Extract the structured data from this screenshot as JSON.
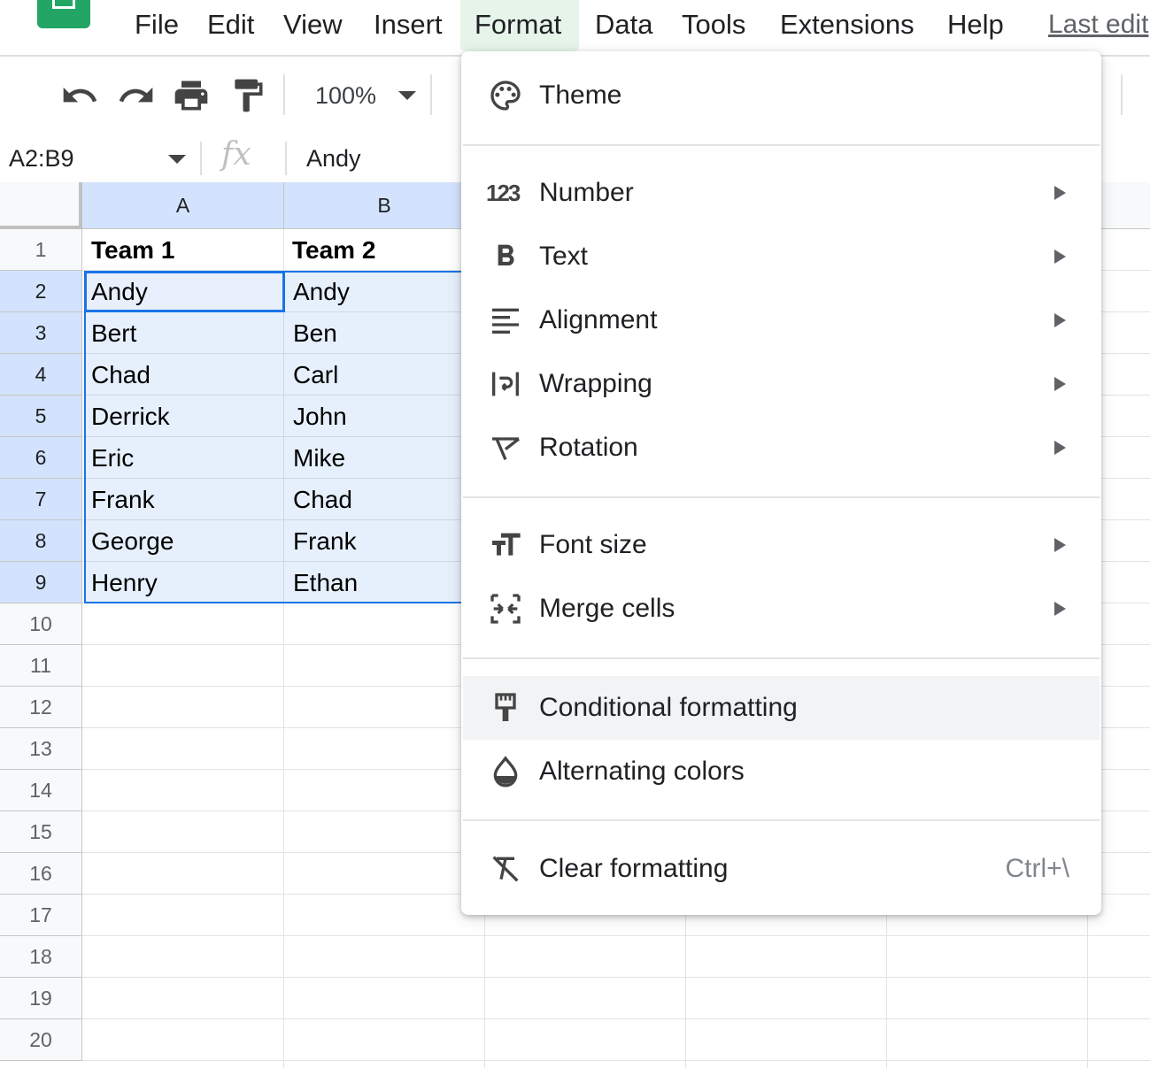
{
  "menubar": {
    "items": [
      "File",
      "Edit",
      "View",
      "Insert",
      "Format",
      "Data",
      "Tools",
      "Extensions",
      "Help"
    ],
    "active": "Format",
    "last_edit": "Last edit"
  },
  "toolbar": {
    "zoom": "100%",
    "icons": [
      "undo-icon",
      "redo-icon",
      "print-icon",
      "paint-format-icon"
    ]
  },
  "formula_bar": {
    "name_box": "A2:B9",
    "fx": "fx",
    "value": "Andy"
  },
  "sheet": {
    "columns": [
      "A",
      "B"
    ],
    "rows": [
      "1",
      "2",
      "3",
      "4",
      "5",
      "6",
      "7",
      "8",
      "9",
      "10",
      "11",
      "12",
      "13",
      "14",
      "15",
      "16",
      "17",
      "18",
      "19",
      "20"
    ],
    "header": [
      "Team 1",
      "Team 2"
    ],
    "data": [
      [
        "Andy",
        "Andy"
      ],
      [
        "Bert",
        "Ben"
      ],
      [
        "Chad",
        "Carl"
      ],
      [
        "Derrick",
        "John"
      ],
      [
        "Eric",
        "Mike"
      ],
      [
        "Frank",
        "Chad"
      ],
      [
        "George",
        "Frank"
      ],
      [
        "Henry",
        "Ethan"
      ]
    ]
  },
  "format_menu": {
    "theme": "Theme",
    "number": "Number",
    "text": "Text",
    "alignment": "Alignment",
    "wrapping": "Wrapping",
    "rotation": "Rotation",
    "font_size": "Font size",
    "merge_cells": "Merge cells",
    "conditional_formatting": "Conditional formatting",
    "alternating_colors": "Alternating colors",
    "clear_formatting": "Clear formatting",
    "clear_shortcut": "Ctrl+\\",
    "number_icon_text": "123"
  },
  "colors": {
    "accent": "#1a73e8",
    "logo": "#23a566",
    "active_menu_bg": "#e6f4ea",
    "hover_bg": "#f1f3f4"
  }
}
